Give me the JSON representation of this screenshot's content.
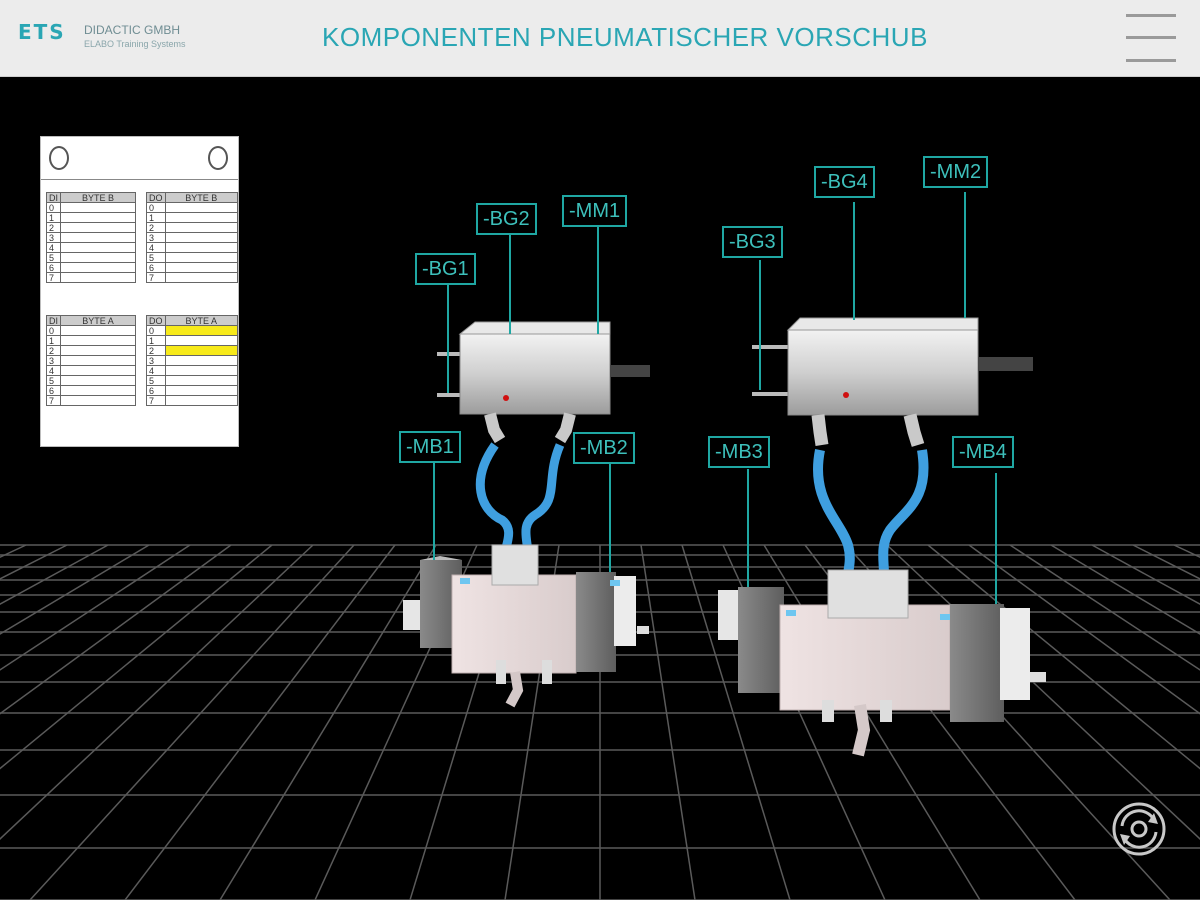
{
  "header": {
    "logo_mark": "ETS",
    "company": "DIDACTIC GMBH",
    "tagline": "ELABO Training Systems",
    "title": "KOMPONENTEN PNEUMATISCHER VORSCHUB"
  },
  "io_panel": {
    "tables": [
      {
        "col1": "DI",
        "col2": "BYTE B",
        "rows": [
          "0",
          "1",
          "2",
          "3",
          "4",
          "5",
          "6",
          "7"
        ],
        "highlighted": []
      },
      {
        "col1": "DO",
        "col2": "BYTE B",
        "rows": [
          "0",
          "1",
          "2",
          "3",
          "4",
          "5",
          "6",
          "7"
        ],
        "highlighted": []
      },
      {
        "col1": "DI",
        "col2": "BYTE A",
        "rows": [
          "0",
          "1",
          "2",
          "3",
          "4",
          "5",
          "6",
          "7"
        ],
        "highlighted": []
      },
      {
        "col1": "DO",
        "col2": "BYTE A",
        "rows": [
          "0",
          "1",
          "2",
          "3",
          "4",
          "5",
          "6",
          "7"
        ],
        "highlighted": [
          0,
          2
        ]
      }
    ],
    "highlight_color": "#f7ea1a"
  },
  "labels": {
    "bg1": "-BG1",
    "bg2": "-BG2",
    "mm1": "-MM1",
    "mb1": "-MB1",
    "mb2": "-MB2",
    "bg3": "-BG3",
    "bg4": "-BG4",
    "mm2": "-MM2",
    "mb3": "-MB3",
    "mb4": "-MB4"
  },
  "icons": {
    "menu": "hamburger-menu-icon",
    "rotate": "rotate-view-icon"
  },
  "colors": {
    "accent": "#2aa6b4",
    "label_border": "#1fa7a3",
    "hose": "#3f9fe0",
    "background": "#000000"
  }
}
